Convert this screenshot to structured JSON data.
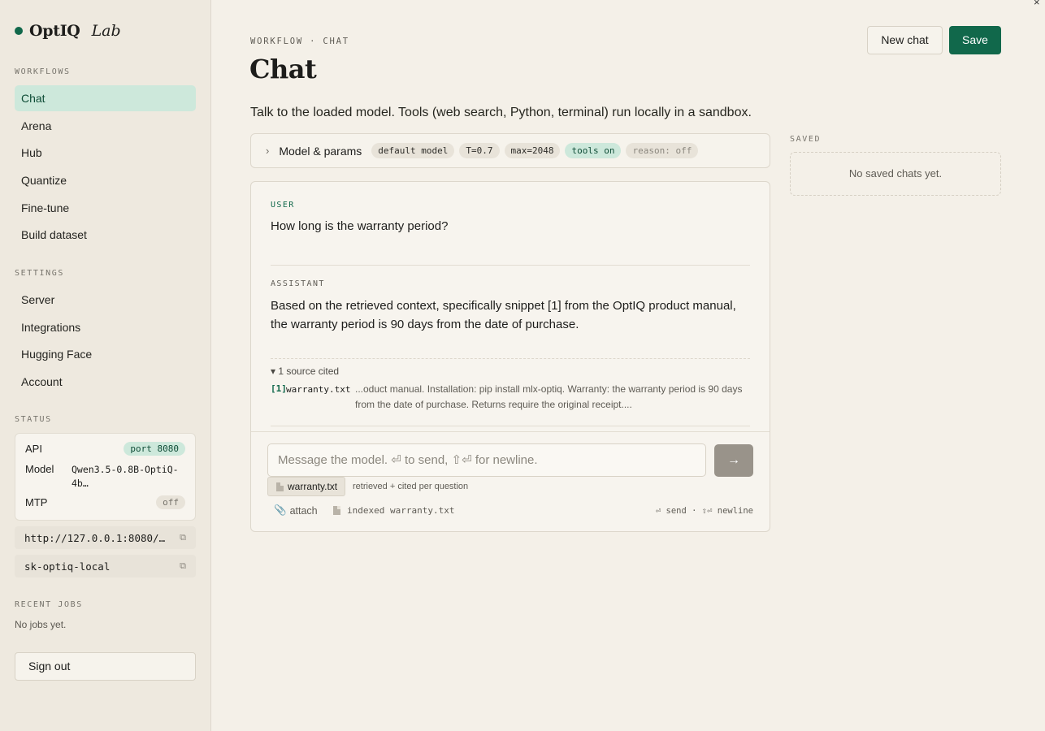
{
  "app": {
    "brand": "OptIQ",
    "brand_suffix": "Lab",
    "accent_color": "#11684b"
  },
  "sidebar": {
    "workflows_heading": "WORKFLOWS",
    "workflows": [
      {
        "label": "Chat",
        "active": true
      },
      {
        "label": "Arena"
      },
      {
        "label": "Hub"
      },
      {
        "label": "Quantize"
      },
      {
        "label": "Fine-tune"
      },
      {
        "label": "Build dataset"
      }
    ],
    "settings_heading": "SETTINGS",
    "settings": [
      {
        "label": "Server"
      },
      {
        "label": "Integrations"
      },
      {
        "label": "Hugging Face"
      },
      {
        "label": "Account"
      }
    ],
    "status_heading": "STATUS",
    "status": {
      "api_label": "API",
      "api_value": "port 8080",
      "model_label": "Model",
      "model_value": "Qwen3.5-0.8B-OptiQ-4b…",
      "mtp_label": "MTP",
      "mtp_value": "off"
    },
    "endpoint_url": "http://127.0.0.1:8080/…",
    "api_key": "sk-optiq-local",
    "copy_icon": "⧉",
    "recent_jobs_heading": "RECENT JOBS",
    "recent_jobs_empty": "No jobs yet.",
    "sign_out": "Sign out"
  },
  "header": {
    "breadcrumb": "WORKFLOW · CHAT",
    "title": "Chat",
    "new_chat": "New chat",
    "save": "Save",
    "close": "×"
  },
  "main": {
    "description": "Talk to the loaded model. Tools (web search, Python, terminal) run locally in a sandbox.",
    "params": {
      "toggle_icon": "›",
      "label": "Model & params",
      "chips": [
        "default model",
        "T=0.7",
        "max=2048",
        "tools on",
        "reason: off"
      ]
    },
    "messages": [
      {
        "role": "USER",
        "text": "How long is the warranty period?"
      },
      {
        "role": "ASSISTANT",
        "text": "Based on the retrieved context, specifically snippet [1] from the OptIQ product manual, the warranty period is 90 days from the date of purchase."
      }
    ],
    "sources": {
      "toggle": "1 source cited",
      "items": [
        {
          "num": "[1]",
          "file": "warranty.txt",
          "snippet": "...oduct manual. Installation: pip install mlx-optiq. Warranty: the warranty period is 90 days from the date of purchase. Returns require the original receipt...."
        }
      ]
    },
    "composer": {
      "placeholder": "Message the model. ⏎ to send, ⇧⏎ for newline.",
      "send_icon": "→",
      "attachment": "warranty.txt",
      "attachment_note": "retrieved + cited per question",
      "attach_label": "attach",
      "indexed_label": "indexed warranty.txt",
      "shortcut_hint": "⏎ send · ⇧⏎ newline"
    }
  },
  "saved": {
    "heading": "SAVED",
    "empty": "No saved chats yet."
  }
}
